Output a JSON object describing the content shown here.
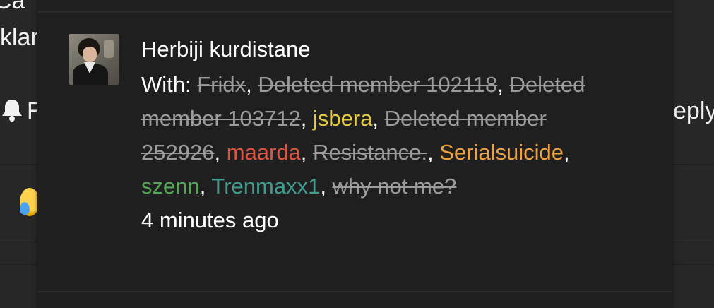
{
  "background": {
    "fragment_top_left": "Ca",
    "fragment_left": "klar",
    "fragment_left_button": "R",
    "fragment_right": "eply"
  },
  "notification": {
    "title": "Herbiji kurdistane",
    "with_label": "With:",
    "participants": [
      {
        "name": "Fridx",
        "deleted": true,
        "color": "#9c9c9c"
      },
      {
        "name": "Deleted member 102118",
        "deleted": true,
        "color": "#9c9c9c"
      },
      {
        "name": "Deleted member 103712",
        "deleted": true,
        "color": "#9c9c9c"
      },
      {
        "name": "jsbera",
        "deleted": false,
        "color": "#e6cc3d"
      },
      {
        "name": "Deleted member 252926",
        "deleted": true,
        "color": "#9c9c9c"
      },
      {
        "name": "maarda",
        "deleted": false,
        "color": "#e0543f"
      },
      {
        "name": "Resistance.",
        "deleted": true,
        "color": "#9c9c9c"
      },
      {
        "name": "Serialsuicide",
        "deleted": false,
        "color": "#f0a23c"
      },
      {
        "name": "szenn",
        "deleted": false,
        "color": "#54a657"
      },
      {
        "name": "Trenmaxx1",
        "deleted": false,
        "color": "#3f9c8f"
      },
      {
        "name": "why not me?",
        "deleted": true,
        "color": "#9c9c9c"
      }
    ],
    "separator": ", ",
    "time": "4 minutes ago"
  },
  "icons": {
    "bell": "bell-icon",
    "emoji": "crying-laughing-emoji-icon",
    "avatar": "user-avatar"
  }
}
